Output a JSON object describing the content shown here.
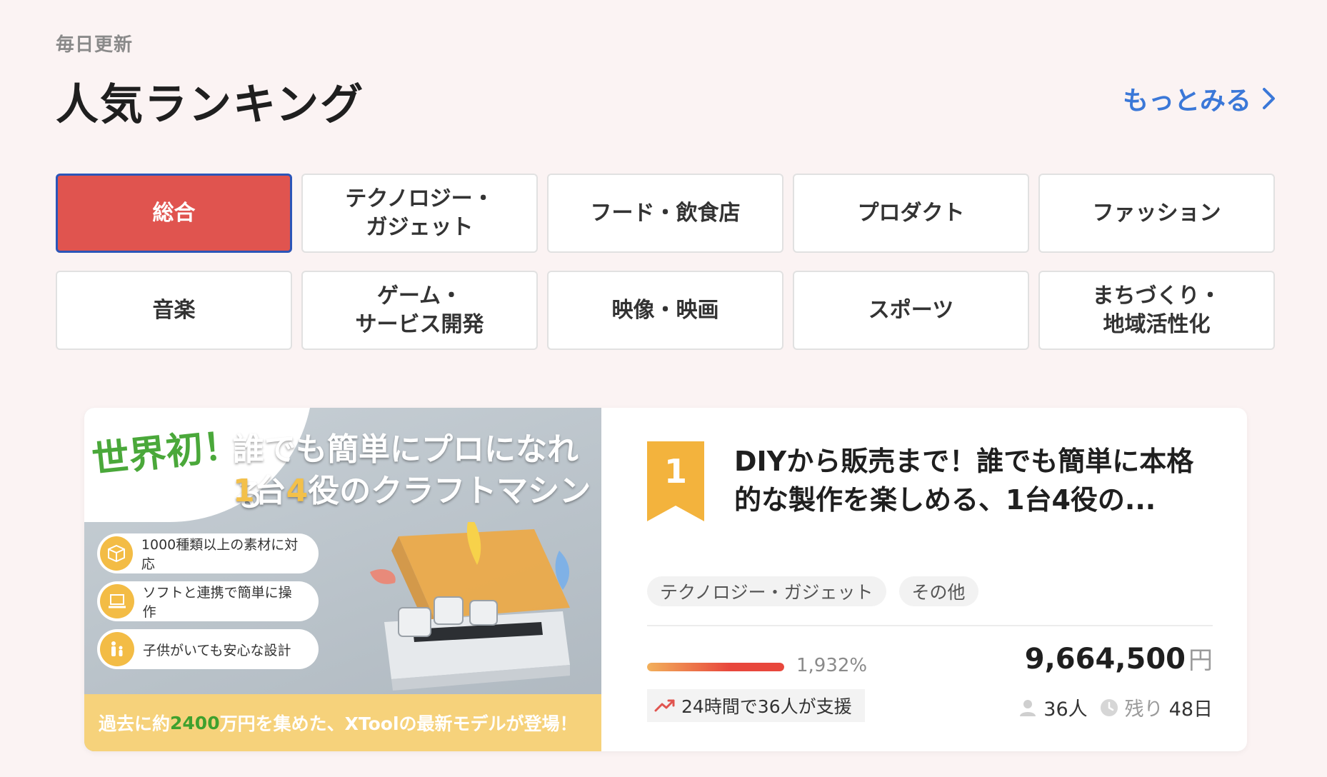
{
  "header": {
    "eyebrow": "毎日更新",
    "title": "人気ランキング",
    "more_label": "もっとみる"
  },
  "categories": [
    {
      "label": "総合",
      "active": true
    },
    {
      "label": "テクノロジー・\nガジェット"
    },
    {
      "label": "フード・飲食店"
    },
    {
      "label": "プロダクト"
    },
    {
      "label": "ファッション"
    },
    {
      "label": "音楽"
    },
    {
      "label": "ゲーム・\nサービス開発"
    },
    {
      "label": "映像・映画"
    },
    {
      "label": "スポーツ"
    },
    {
      "label": "まちづくり・\n地域活性化"
    }
  ],
  "project": {
    "image": {
      "badge": "世界初！",
      "headline_1": "誰でも簡単にプロになれる",
      "headline_2_num1": "1",
      "headline_2_mid": "台",
      "headline_2_num2": "4",
      "headline_2_end": "役のクラフトマシン",
      "features": [
        "1000種類以上の素材に対応",
        "ソフトと連携で簡単に操作",
        "子供がいても安心な設計"
      ],
      "footer_pre": "過去に約",
      "footer_num": "2400",
      "footer_post": "万円を集めた、XToolの最新モデルが登場！"
    },
    "rank": "1",
    "title": "DIYから販売まで！誰でも簡単に本格的な製作を楽しめる、1台4役の...",
    "tags": [
      "テクノロジー・ガジェット",
      "その他"
    ],
    "progress_percent": 1932,
    "progress_label": "1,932%",
    "amount": "9,664,500",
    "currency": "円",
    "support_text": "24時間で36人が支援",
    "supporters": "36人",
    "remaining_label": "残り",
    "remaining_days": "48日"
  },
  "colors": {
    "active_bg": "#e0544f",
    "active_border": "#2c55b8",
    "link": "#3b78d8",
    "rank_ribbon": "#f3b33d"
  }
}
